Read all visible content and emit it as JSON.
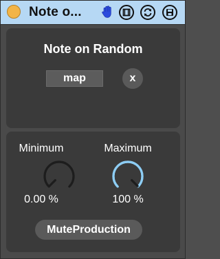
{
  "titlebar": {
    "title": "Note o...",
    "icons": [
      "power-icon",
      "hand-icon",
      "device-icon",
      "sync-icon",
      "save-icon"
    ]
  },
  "colors": {
    "titlebar_bg": "#b6d8f4",
    "power": "#f2b447",
    "panel_bg": "#3a3a3a",
    "device_bg": "#4a4a4a",
    "dial_active": "#8dcdf4",
    "dial_inactive": "#1d1d1d"
  },
  "top_panel": {
    "title": "Note on Random",
    "map_label": "map",
    "clear_label": "x"
  },
  "bottom_panel": {
    "minimum": {
      "label": "Minimum",
      "value_text": "0.00 %",
      "level": 0.0
    },
    "maximum": {
      "label": "Maximum",
      "value_text": "100 %",
      "level": 1.0
    },
    "mute_label": "MuteProduction"
  }
}
